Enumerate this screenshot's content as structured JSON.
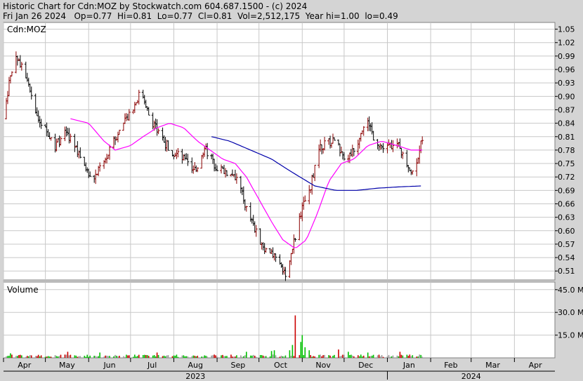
{
  "header": {
    "line1": "Historic Chart for Cdn:MOZ by Stockwatch.com 604.687.1500 - (c) 2024",
    "line2": "Fri Jan 26 2024   Op=0.77  Hi=0.81  Lo=0.77  Cl=0.81  Vol=2,512,175  Year hi=1.00  lo=0.49"
  },
  "price_panel": {
    "label": "Cdn:MOZ",
    "yticks": [
      "1.05",
      "1.02",
      "0.99",
      "0.96",
      "0.93",
      "0.90",
      "0.87",
      "0.84",
      "0.81",
      "0.78",
      "0.75",
      "0.72",
      "0.69",
      "0.66",
      "0.63",
      "0.60",
      "0.57",
      "0.54",
      "0.51"
    ]
  },
  "volume_panel": {
    "label": "Volume",
    "yticks": [
      "45.0 M",
      "30.0 M",
      "15.0 M"
    ]
  },
  "x_axis": {
    "months": [
      "Apr",
      "May",
      "Jun",
      "Jul",
      "Aug",
      "Sep",
      "Oct",
      "Nov",
      "Dec",
      "Jan",
      "Feb",
      "Mar",
      "Apr"
    ],
    "years": [
      "2023",
      "2024"
    ]
  },
  "colors": {
    "background": "#d4d4d4",
    "plot_bg": "#ffffff",
    "grid": "#c8c8c8",
    "up_bar": "#8b0000",
    "down_bar": "#000000",
    "ma_short": "#ff00ff",
    "ma_long": "#0000aa",
    "vol_up": "#00c000",
    "vol_down": "#cc0000",
    "vol_flat": "#999999"
  },
  "chart_data": {
    "type": "ohlc",
    "title": "Historic Chart for Cdn:MOZ by Stockwatch.com 604.687.1500 - (c) 2024",
    "ylim": [
      0.49,
      1.065
    ],
    "volume_ylim": [
      0,
      50
    ],
    "volume_unit": "M",
    "x_range": [
      "2023-04-01",
      "2024-04-30"
    ],
    "price_anchors": [
      [
        "2023-04-01",
        0.85
      ],
      [
        "2023-04-05",
        0.93
      ],
      [
        "2023-04-10",
        0.99
      ],
      [
        "2023-04-16",
        0.96
      ],
      [
        "2023-04-22",
        0.88
      ],
      [
        "2023-04-30",
        0.83
      ],
      [
        "2023-05-08",
        0.79
      ],
      [
        "2023-05-16",
        0.82
      ],
      [
        "2023-05-24",
        0.78
      ],
      [
        "2023-06-03",
        0.71
      ],
      [
        "2023-06-12",
        0.75
      ],
      [
        "2023-06-22",
        0.82
      ],
      [
        "2023-07-01",
        0.86
      ],
      [
        "2023-07-08",
        0.91
      ],
      [
        "2023-07-14",
        0.86
      ],
      [
        "2023-07-22",
        0.81
      ],
      [
        "2023-07-30",
        0.78
      ],
      [
        "2023-08-08",
        0.76
      ],
      [
        "2023-08-15",
        0.73
      ],
      [
        "2023-08-24",
        0.78
      ],
      [
        "2023-09-01",
        0.74
      ],
      [
        "2023-09-09",
        0.73
      ],
      [
        "2023-09-16",
        0.71
      ],
      [
        "2023-09-23",
        0.64
      ],
      [
        "2023-10-01",
        0.58
      ],
      [
        "2023-10-08",
        0.55
      ],
      [
        "2023-10-16",
        0.53
      ],
      [
        "2023-10-21",
        0.5
      ],
      [
        "2023-10-25",
        0.56
      ],
      [
        "2023-11-01",
        0.65
      ],
      [
        "2023-11-07",
        0.7
      ],
      [
        "2023-11-14",
        0.79
      ],
      [
        "2023-11-24",
        0.8
      ],
      [
        "2023-12-02",
        0.76
      ],
      [
        "2023-12-09",
        0.78
      ],
      [
        "2023-12-16",
        0.85
      ],
      [
        "2023-12-22",
        0.81
      ],
      [
        "2023-12-30",
        0.78
      ],
      [
        "2024-01-07",
        0.8
      ],
      [
        "2024-01-13",
        0.76
      ],
      [
        "2024-01-19",
        0.73
      ],
      [
        "2024-01-23",
        0.77
      ],
      [
        "2024-01-26",
        0.81
      ]
    ],
    "ma_short_anchors": [
      [
        "2023-05-19",
        0.85
      ],
      [
        "2023-06-01",
        0.84
      ],
      [
        "2023-06-12",
        0.8
      ],
      [
        "2023-06-20",
        0.78
      ],
      [
        "2023-07-01",
        0.79
      ],
      [
        "2023-07-10",
        0.81
      ],
      [
        "2023-07-20",
        0.83
      ],
      [
        "2023-07-29",
        0.84
      ],
      [
        "2023-08-08",
        0.83
      ],
      [
        "2023-08-18",
        0.8
      ],
      [
        "2023-08-27",
        0.78
      ],
      [
        "2023-09-05",
        0.76
      ],
      [
        "2023-09-14",
        0.75
      ],
      [
        "2023-09-22",
        0.72
      ],
      [
        "2023-10-01",
        0.67
      ],
      [
        "2023-10-10",
        0.62
      ],
      [
        "2023-10-18",
        0.58
      ],
      [
        "2023-10-27",
        0.56
      ],
      [
        "2023-11-04",
        0.58
      ],
      [
        "2023-11-12",
        0.64
      ],
      [
        "2023-11-20",
        0.71
      ],
      [
        "2023-11-29",
        0.75
      ],
      [
        "2023-12-08",
        0.76
      ],
      [
        "2023-12-18",
        0.79
      ],
      [
        "2023-12-28",
        0.8
      ],
      [
        "2024-01-08",
        0.79
      ],
      [
        "2024-01-18",
        0.78
      ],
      [
        "2024-01-26",
        0.78
      ]
    ],
    "ma_long_anchors": [
      [
        "2023-08-28",
        0.81
      ],
      [
        "2023-09-10",
        0.8
      ],
      [
        "2023-09-25",
        0.78
      ],
      [
        "2023-10-10",
        0.76
      ],
      [
        "2023-10-25",
        0.73
      ],
      [
        "2023-11-10",
        0.7
      ],
      [
        "2023-11-25",
        0.69
      ],
      [
        "2023-12-10",
        0.69
      ],
      [
        "2023-12-25",
        0.695
      ],
      [
        "2024-01-10",
        0.698
      ],
      [
        "2024-01-26",
        0.7
      ]
    ],
    "volume_spikes": [
      [
        "2023-10-29",
        45.0
      ],
      [
        "2023-10-27",
        28.0
      ],
      [
        "2023-11-01",
        15.0
      ],
      [
        "2023-10-31",
        10.5
      ],
      [
        "2023-10-25",
        8.5
      ],
      [
        "2023-11-03",
        7.0
      ],
      [
        "2023-11-06",
        5.0
      ],
      [
        "2023-10-23",
        5.0
      ],
      [
        "2023-11-27",
        5.5
      ],
      [
        "2023-12-04",
        4.0
      ],
      [
        "2023-10-10",
        4.5
      ],
      [
        "2023-10-12",
        5.0
      ],
      [
        "2023-09-22",
        4.0
      ],
      [
        "2023-05-17",
        4.0
      ],
      [
        "2023-04-06",
        3.0
      ],
      [
        "2023-07-20",
        3.5
      ],
      [
        "2024-01-10",
        4.0
      ],
      [
        "2023-12-18",
        3.5
      ],
      [
        "2023-06-09",
        3.5
      ]
    ]
  }
}
